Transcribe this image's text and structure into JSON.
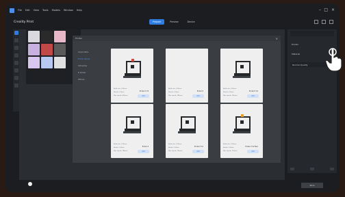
{
  "menubar": {
    "items": [
      "File",
      "Edit",
      "View",
      "Tools",
      "Models",
      "Window",
      "Help"
    ]
  },
  "window": {
    "title": "Creality Print",
    "controls": [
      "–",
      "□",
      "×"
    ]
  },
  "tabs": [
    {
      "label": "Prepare",
      "active": true
    },
    {
      "label": "Preview",
      "active": false
    },
    {
      "label": "Device",
      "active": false
    }
  ],
  "dialog": {
    "title": "Printer",
    "close": "×",
    "side_items": [
      {
        "label": "All printers",
        "active": false
      },
      {
        "label": "Ender series",
        "active": true
      },
      {
        "label": "CR series",
        "active": false
      },
      {
        "label": "K series",
        "active": false
      },
      {
        "label": "Others",
        "active": false
      }
    ],
    "printers": [
      {
        "name": "Ender-3 V3",
        "button": "Add",
        "accent": "#d8483c",
        "specs": [
          "Build size: 220mm",
          "Nozzle: 0.4mm",
          "Max speed: 600mm"
        ]
      },
      {
        "name": "Ender-5",
        "button": "Add",
        "accent": "",
        "specs": [
          "Build size: 220mm",
          "Nozzle: 0.4mm",
          "Max speed: 180mm"
        ]
      },
      {
        "name": "Ender-5 S1",
        "button": "Add",
        "accent": "",
        "specs": [
          "Build size: 220mm",
          "Nozzle: 0.4mm",
          "Max speed: 250mm"
        ]
      },
      {
        "name": "Ender-3",
        "button": "Add",
        "accent": "",
        "specs": [
          "Build size: 220mm",
          "Nozzle: 0.4mm",
          "Max speed: 180mm"
        ]
      },
      {
        "name": "Ender-3 S1",
        "button": "Add",
        "accent": "",
        "specs": [
          "Build size: 220mm",
          "Nozzle: 0.4mm",
          "Max speed: 150mm"
        ]
      },
      {
        "name": "Ender-3 V2 Neo",
        "button": "Add",
        "accent": "#f0a020",
        "specs": [
          "Build size: 220mm",
          "Nozzle: 0.4mm",
          "Max speed: 120mm"
        ]
      }
    ]
  },
  "right_panel": {
    "lines": [
      "Printer",
      "Material"
    ],
    "select": "Normal Quality"
  },
  "slice_button": "Slice",
  "colors": {
    "accent": "#2f7de1",
    "background": "#1b1d20",
    "card": "#efeff0"
  },
  "icons": [
    "app-logo-icon",
    "hand-cursor-icon",
    "light-icon"
  ]
}
